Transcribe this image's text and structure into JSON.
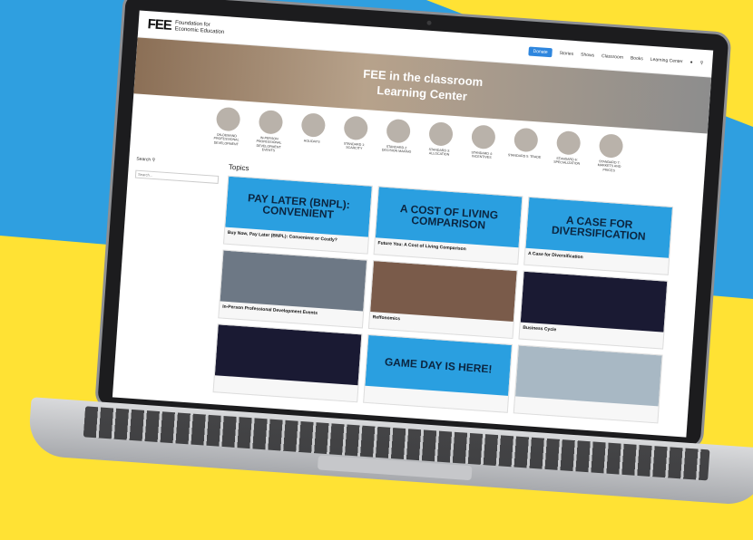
{
  "brand": {
    "logo_mark": "FEE",
    "logo_line1": "Foundation for",
    "logo_line2": "Economic Education"
  },
  "nav": {
    "items": [
      "Stories",
      "Shows",
      "Classroom",
      "Books",
      "Learning Center"
    ],
    "active": "Donate"
  },
  "hero": {
    "logo": "FEE in the classroom",
    "title": "Learning Center"
  },
  "categories": [
    "ON-DEMAND PROFESSIONAL DEVELOPMENT",
    "IN-PERSON PROFESSIONAL DEVELOPMENT EVENTS",
    "HOLIDAYS",
    "STANDARD 1: SCARCITY",
    "STANDARD 2: DECISION MAKING",
    "STANDARD 3: ALLOCATION",
    "STANDARD 4: INCENTIVES",
    "STANDARD 5: TRADE",
    "STANDARD 6: SPECIALIZATION",
    "STANDARD 7: MARKETS AND PRICES"
  ],
  "sidebar": {
    "search_label": "Search",
    "search_placeholder": "Search..."
  },
  "main": {
    "title": "Topics"
  },
  "cards": [
    {
      "image_text": "PAY LATER (BNPL): CONVENIENT",
      "title": "Buy Now, Pay Later (BNPL): Convenient or Costly?",
      "color": "#2a9fe0"
    },
    {
      "image_text": "A COST OF LIVING COMPARISON",
      "title": "Future You: A Cost of Living Comparison",
      "color": "#2a9fe0"
    },
    {
      "image_text": "A CASE FOR DIVERSIFICATION",
      "title": "A Case for Diversification",
      "color": "#2a9fe0"
    },
    {
      "image_text": "",
      "title": "In-Person Professional Development Events",
      "color": "#6d7885"
    },
    {
      "image_text": "",
      "title": "Reffonomics",
      "color": "#7a5b4a"
    },
    {
      "image_text": "",
      "title": "Business Cycle",
      "color": "#1a1a33"
    },
    {
      "image_text": "",
      "title": "",
      "color": "#1a1a33"
    },
    {
      "image_text": "GAME DAY IS HERE!",
      "title": "",
      "color": "#2a9fe0"
    },
    {
      "image_text": "",
      "title": "",
      "color": "#a8b8c4"
    }
  ],
  "colors": {
    "background_blue": "#2f9fe0",
    "background_yellow": "#ffe234",
    "accent_blue": "#2e86de"
  }
}
